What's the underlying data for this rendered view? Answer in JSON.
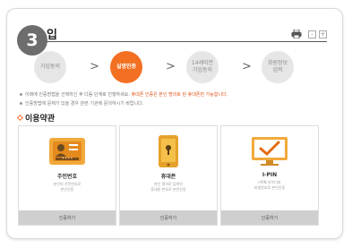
{
  "header": {
    "step_number": "3",
    "title": "입",
    "font_small": "-",
    "font_large": "+"
  },
  "steps": [
    {
      "label": "가입동의",
      "state": "done"
    },
    {
      "label": "실명인증",
      "state": "active"
    },
    {
      "label": "14세미만\n가입동의",
      "state": "todo"
    },
    {
      "label": "회원정보\n입력",
      "state": "todo"
    }
  ],
  "notice": {
    "line1_prefix": "아래에 인증방법을 선택하신 후 다음 단계로 진행하세요.",
    "line1_highlight": "휴대폰 인증은 본인 명의로 된 휴대폰만 가능합니다.",
    "line2": "인증방법에 문제가 있을 경우 관련 기관에 문의하시기 바랍니다."
  },
  "section": {
    "title": "이용약관"
  },
  "options": [
    {
      "name": "주민번호",
      "desc": "본인의 주민번호로\n본인인증",
      "button": "인증하기",
      "icon": "id-card-icon"
    },
    {
      "name": "휴대폰",
      "desc": "본인 명의로 등록된\n휴대폰 번호로 본인인증",
      "button": "인증하기",
      "icon": "phone-lock-icon"
    },
    {
      "name": "I-PIN",
      "desc": "I-PIN 아이디와\n비밀번호로 본인인증",
      "button": "인증하기",
      "icon": "monitor-check-icon"
    }
  ],
  "colors": {
    "accent": "#f36f21",
    "step_inactive": "#e6e6e6",
    "badge": "#6d6d6d",
    "button": "#cfcfcf"
  }
}
